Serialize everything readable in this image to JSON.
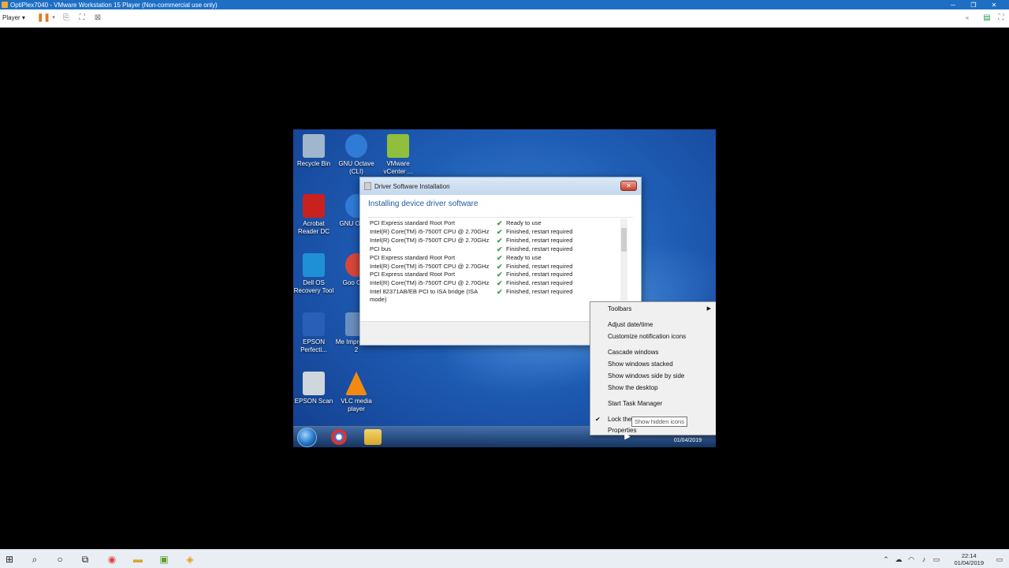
{
  "vm_window": {
    "title": "OptiPlex7040 - VMware Workstation 15 Player (Non-commercial use only)",
    "player_menu": "Player ▾",
    "controls": {
      "minimize": "─",
      "restore": "❐",
      "close": "✕"
    }
  },
  "desktop_icons": [
    {
      "name": "desk-icon-recycle-bin",
      "label": "Recycle Bin",
      "color": "#9fb6cc"
    },
    {
      "name": "desk-icon-gnu-octave-cli",
      "label": "GNU Octave (CLI)",
      "color": "#2f7bd6"
    },
    {
      "name": "desk-icon-vmware-vcenter",
      "label": "VMware vCenter ...",
      "color": "#8fbf3d"
    },
    {
      "name": "desk-icon-acrobat",
      "label": "Acrobat Reader DC",
      "color": "#c9211e"
    },
    {
      "name": "desk-icon-gnu-octave-gui",
      "label": "GNU O (GU",
      "color": "#2f7bd6"
    },
    {
      "name": "desk-icon-dell-os-recovery",
      "label": "Dell OS Recovery Tool",
      "color": "#1f8fd6"
    },
    {
      "name": "desk-icon-google-chrome",
      "label": "Goo Chro",
      "color": "#d9463a"
    },
    {
      "name": "desk-icon-epson-perfection",
      "label": "EPSON Perfecti...",
      "color": "#2a5fb8"
    },
    {
      "name": "desk-icon-media-impression",
      "label": "Me Impression 2",
      "color": "#6a8fbf"
    },
    {
      "name": "desk-icon-epson-scan",
      "label": "EPSON Scan",
      "color": "#cfd6dd"
    },
    {
      "name": "desk-icon-vlc",
      "label": "VLC media player",
      "color": "#f28a12"
    }
  ],
  "dialog": {
    "title": "Driver Software Installation",
    "heading": "Installing device driver software",
    "close_label": "✕",
    "rows": [
      {
        "device": "PCI Express standard Root Port",
        "status": "Ready to use"
      },
      {
        "device": "Intel(R) Core(TM) i5-7500T CPU @ 2.70GHz",
        "status": "Finished, restart required"
      },
      {
        "device": "Intel(R) Core(TM) i5-7500T CPU @ 2.70GHz",
        "status": "Finished, restart required"
      },
      {
        "device": "PCI bus",
        "status": "Finished, restart required"
      },
      {
        "device": "PCI Express standard Root Port",
        "status": "Ready to use"
      },
      {
        "device": "Intel(R) Core(TM) i5-7500T CPU @ 2.70GHz",
        "status": "Finished, restart required"
      },
      {
        "device": "PCI Express standard Root Port",
        "status": "Finished, restart required"
      },
      {
        "device": "Intel(R) Core(TM) i5-7500T CPU @ 2.70GHz",
        "status": "Finished, restart required"
      },
      {
        "device": "Intel 82371AB/EB PCI to ISA bridge (ISA mode)",
        "status": "Finished, restart required"
      }
    ]
  },
  "context_menu": {
    "toolbars": "Toolbars",
    "adjust_datetime": "Adjust date/time",
    "customize_icons": "Customize notification icons",
    "cascade": "Cascade windows",
    "stacked": "Show windows stacked",
    "side_by_side": "Show windows side by side",
    "show_desktop": "Show the desktop",
    "task_manager": "Start Task Manager",
    "lock_taskbar": "Lock the t...b...",
    "properties": "Properties"
  },
  "tooltip": "Show hidden icons",
  "guest_clock": "01/04/2019",
  "host_clock": {
    "time": "22:14",
    "date": "01/04/2019"
  }
}
